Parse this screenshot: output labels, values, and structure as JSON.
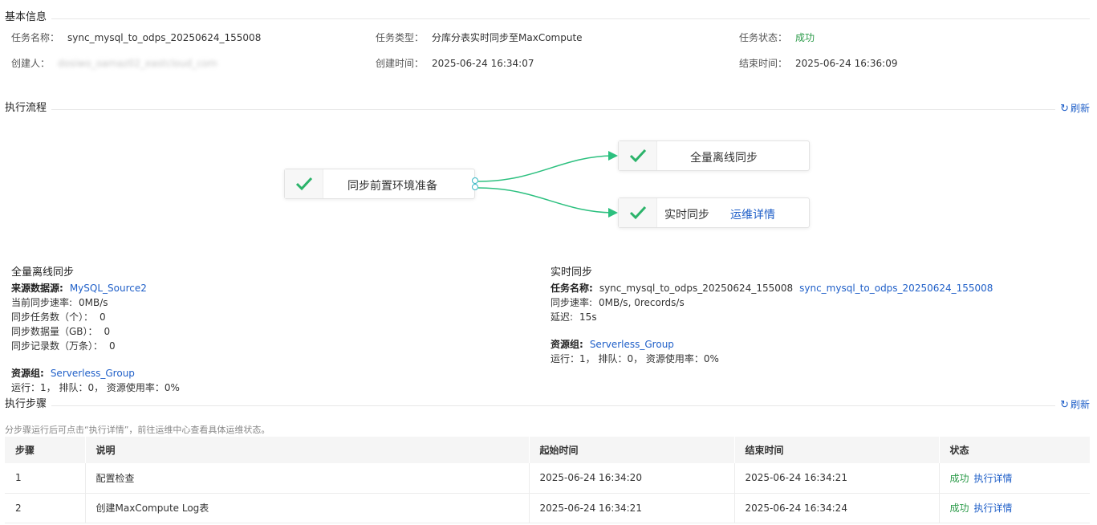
{
  "basic": {
    "title": "基本信息",
    "task_name_label": "任务名称：",
    "task_name": "sync_mysql_to_odps_20250624_155008",
    "task_type_label": "任务类型：",
    "task_type": "分库分表实时同步至MaxCompute",
    "task_status_label": "任务状态：",
    "task_status": "成功",
    "creator_label": "创建人：",
    "creator": "dosiwo_oamaz02_eastcloud_com",
    "create_time_label": "创建时间：",
    "create_time": "2025-06-24 16:34:07",
    "end_time_label": "结束时间：",
    "end_time": "2025-06-24 16:36:09"
  },
  "flow": {
    "title": "执行流程",
    "refresh": "刷新",
    "node_prepare": "同步前置环境准备",
    "node_full": "全量离线同步",
    "node_realtime": "实时同步",
    "node_realtime_link": "运维详情"
  },
  "full_sync": {
    "title": "全量离线同步",
    "source_label": "来源数据源:",
    "source": "MySQL_Source2",
    "speed_label": "当前同步速率:",
    "speed": "0MB/s",
    "tasks_label": "同步任务数（个）：",
    "tasks": "0",
    "volume_label": "同步数据量（GB）：",
    "volume": "0",
    "records_label": "同步记录数（万条）：",
    "records": "0",
    "group_label": "资源组:",
    "group": "Serverless_Group",
    "stats": "运行：1，  排队：0，  资源使用率：0%"
  },
  "realtime_sync": {
    "title": "实时同步",
    "task_label": "任务名称:",
    "task_name": "sync_mysql_to_odps_20250624_155008",
    "task_link": "sync_mysql_to_odps_20250624_155008",
    "speed_label": "同步速率:",
    "speed": "0MB/s, 0records/s",
    "delay_label": "延迟:",
    "delay": "15s",
    "group_label": "资源组:",
    "group": "Serverless_Group",
    "stats": "运行：1，  排队：0，  资源使用率：0%"
  },
  "steps": {
    "title": "执行步骤",
    "refresh": "刷新",
    "hint": "分步骤运行后可点击“执行详情”，前往运维中心查看具体运维状态。",
    "columns": [
      "步骤",
      "说明",
      "起始时间",
      "结束时间",
      "状态"
    ],
    "rows": [
      {
        "step": "1",
        "desc": "配置检查",
        "start": "2025-06-24 16:34:20",
        "end": "2025-06-24 16:34:21",
        "status": "成功",
        "detail": "执行详情"
      },
      {
        "step": "2",
        "desc": "创建MaxCompute Log表",
        "start": "2025-06-24 16:34:21",
        "end": "2025-06-24 16:34:24",
        "status": "成功",
        "detail": "执行详情"
      }
    ]
  },
  "colors": {
    "link": "#1f5fc8",
    "success": "#2a9a48",
    "check": "#2bb36a",
    "edge": "#2cc07f"
  },
  "icons": {
    "check": "check-icon",
    "refresh": "refresh-icon"
  }
}
